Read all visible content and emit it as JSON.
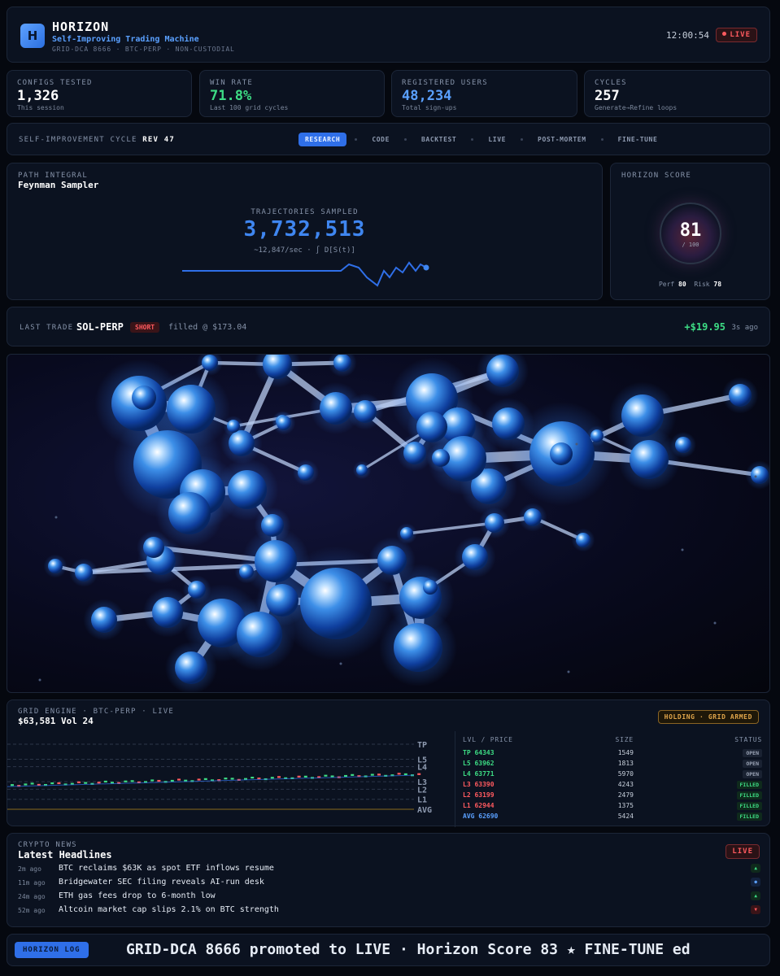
{
  "header": {
    "logo_letter": "H",
    "brand": "HORIZON",
    "tagline": "Self-Improving Trading Machine",
    "subline": "GRID-DCA 8666 · BTC-PERP · NON-CUSTODIAL",
    "clock": "12:00:54",
    "live": "LIVE"
  },
  "stats": [
    {
      "label": "CONFIGS TESTED",
      "value": "1,326",
      "hint": "This session",
      "color": "#ffffff"
    },
    {
      "label": "WIN RATE",
      "value": "71.8%",
      "hint": "Last 100 grid cycles",
      "color": "#3ddc84"
    },
    {
      "label": "REGISTERED USERS",
      "value": "48,234",
      "hint": "Total sign-ups",
      "color": "#5aa0ff"
    },
    {
      "label": "CYCLES",
      "value": "257",
      "hint": "Generate→Refine loops",
      "color": "#ffffff"
    }
  ],
  "cycle": {
    "label": "SELF-IMPROVEMENT CYCLE",
    "rev": "REV 47",
    "steps": [
      "RESEARCH",
      "CODE",
      "BACKTEST",
      "LIVE",
      "POST-MORTEM",
      "FINE-TUNE"
    ],
    "active": 0
  },
  "path": {
    "label": "PATH INTEGRAL",
    "title": "Feynman Sampler",
    "metric_label": "TRAJECTORIES SAMPLED",
    "metric": "3,732,513",
    "rate": "~12,847/sec · ∫ D[S(t)]"
  },
  "score": {
    "label": "HORIZON SCORE",
    "value": "81",
    "of": "/ 100",
    "perf_label": "Perf",
    "perf": "80",
    "risk_label": "Risk",
    "risk": "78",
    "level": 0.81
  },
  "trade": {
    "label": "LAST TRADE",
    "symbol": "SOL-PERP",
    "side": "SHORT",
    "fill": "filled @ $173.04",
    "pnl": "+$19.95",
    "ago": "3s ago"
  },
  "grid": {
    "label": "GRID ENGINE · BTC-PERP · LIVE",
    "price": "$63,581 Vol 24",
    "badge": "HOLDING · GRID ARMED",
    "levels": [
      "TP",
      "L5",
      "L4",
      "L3",
      "L2",
      "L1",
      "AVG"
    ],
    "headers": [
      "LVL / PRICE",
      "SIZE",
      "STATUS"
    ],
    "rows": [
      {
        "lvl": "TP",
        "price": "64343",
        "size": "1549",
        "status": "OPEN",
        "color": "#3ddc84"
      },
      {
        "lvl": "L5",
        "price": "63962",
        "size": "1813",
        "status": "OPEN",
        "color": "#3ddc84"
      },
      {
        "lvl": "L4",
        "price": "63771",
        "size": "5970",
        "status": "OPEN",
        "color": "#3ddc84"
      },
      {
        "lvl": "L3",
        "price": "63390",
        "size": "4243",
        "status": "FILLED",
        "color": "#ff5a5f"
      },
      {
        "lvl": "L2",
        "price": "63199",
        "size": "2479",
        "status": "FILLED",
        "color": "#ff5a5f"
      },
      {
        "lvl": "L1",
        "price": "62944",
        "size": "1375",
        "status": "FILLED",
        "color": "#ff5a5f"
      },
      {
        "lvl": "AVG",
        "price": "62690",
        "size": "5424",
        "status": "FILLED",
        "color": "#5aa0ff"
      }
    ]
  },
  "news": {
    "label": "CRYPTO NEWS",
    "title": "Latest Headlines",
    "live": "LIVE",
    "items": [
      {
        "ago": "2m ago",
        "text": "BTC reclaims $63K as spot ETF inflows resume",
        "dir": "up"
      },
      {
        "ago": "11m ago",
        "text": "Bridgewater SEC filing reveals AI-run desk",
        "dir": "neutral"
      },
      {
        "ago": "24m ago",
        "text": "ETH gas fees drop to 6-month low",
        "dir": "up"
      },
      {
        "ago": "52m ago",
        "text": "Altcoin market cap slips 2.1% on BTC strength",
        "dir": "down"
      }
    ]
  },
  "log": {
    "label": "HORIZON LOG",
    "ticker": "GRID-DCA 8666 promoted to LIVE · Horizon Score 83   ★   FINE-TUNE ed"
  },
  "colors": {
    "accent": "#2f6fe8",
    "green": "#3ddc84",
    "red": "#ff5a5f",
    "orange": "#e0a54a"
  }
}
